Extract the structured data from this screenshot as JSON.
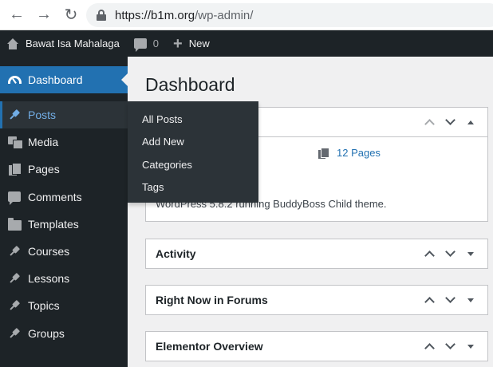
{
  "browser": {
    "url_host": "https://b1m.org",
    "url_path": "/wp-admin/"
  },
  "adminbar": {
    "site_name": "Bawat Isa Mahalaga",
    "comment_count": "0",
    "new_label": "New"
  },
  "sidebar": {
    "items": [
      {
        "label": "Dashboard",
        "icon": "dashboard-icon"
      },
      {
        "label": "Posts",
        "icon": "pin-icon"
      },
      {
        "label": "Media",
        "icon": "media-icon"
      },
      {
        "label": "Pages",
        "icon": "pages-icon"
      },
      {
        "label": "Comments",
        "icon": "comment-icon"
      },
      {
        "label": "Templates",
        "icon": "folder-icon"
      },
      {
        "label": "Courses",
        "icon": "pin-icon"
      },
      {
        "label": "Lessons",
        "icon": "pin-icon"
      },
      {
        "label": "Topics",
        "icon": "pin-icon"
      },
      {
        "label": "Groups",
        "icon": "pin-icon"
      }
    ]
  },
  "flyout": {
    "items": [
      "All Posts",
      "Add New",
      "Categories",
      "Tags"
    ]
  },
  "main": {
    "title": "Dashboard",
    "glance": {
      "pages_link": "12 Pages",
      "version_text": "WordPress 5.8.2 running BuddyBoss Child theme."
    },
    "boxes": [
      "Activity",
      "Right Now in Forums",
      "Elementor Overview"
    ]
  }
}
